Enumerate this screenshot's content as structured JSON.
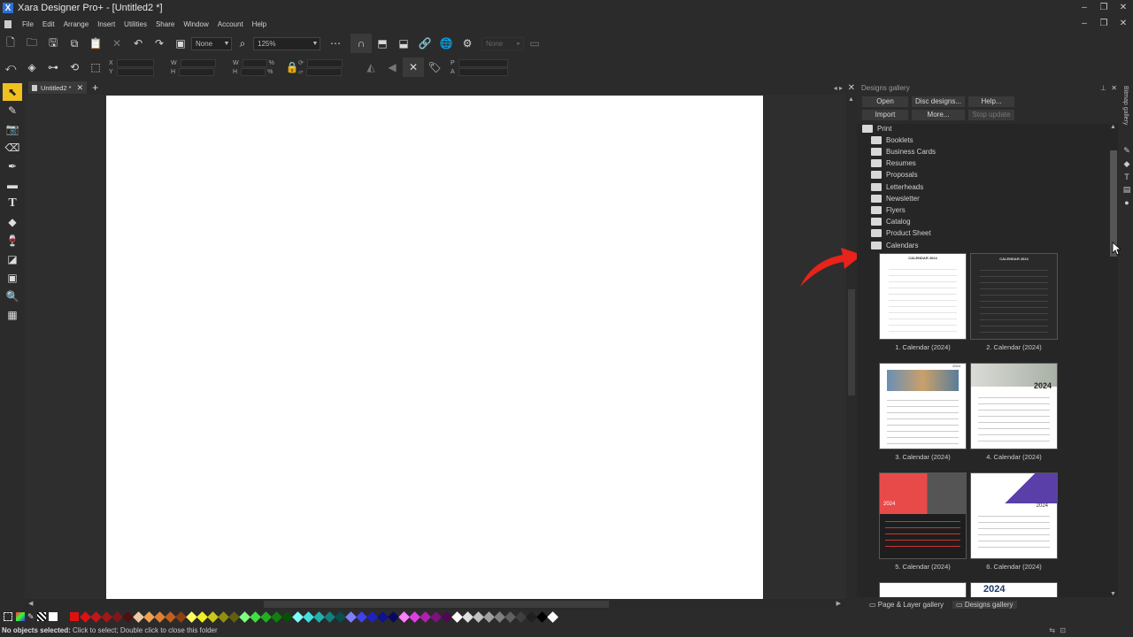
{
  "app": {
    "title": "Xara Designer Pro+ - [Untitled2 *]"
  },
  "menu": [
    "File",
    "Edit",
    "Arrange",
    "Insert",
    "Utilities",
    "Share",
    "Window",
    "Account",
    "Help"
  ],
  "toolbar": {
    "feather_value": "None",
    "zoom_value": "125%",
    "line_value": "None",
    "x_label": "X",
    "y_label": "Y",
    "w_label": "W",
    "h_label": "H",
    "w2_label": "W",
    "h2_label": "H",
    "p_label": "P",
    "a_label": "A",
    "pct1": "%",
    "pct2": "%"
  },
  "document": {
    "tab_label": "Untitled2 *"
  },
  "gallery": {
    "title": "Designs gallery",
    "buttons": {
      "open": "Open",
      "disc_designs": "Disc designs...",
      "help": "Help...",
      "import": "Import",
      "more": "More...",
      "stop_update": "Stop update"
    },
    "root": "Print",
    "folders": [
      "Booklets",
      "Business Cards",
      "Resumes",
      "Proposals",
      "Letterheads",
      "Newsletter",
      "Flyers",
      "Catalog",
      "Product Sheet",
      "Calendars"
    ],
    "items": [
      {
        "caption": "1. Calendar (2024)",
        "header": "CALENDAR 2024"
      },
      {
        "caption": "2. Calendar (2024)",
        "header": "CALENDAR 2024"
      },
      {
        "caption": "3. Calendar (2024)",
        "header": "2024"
      },
      {
        "caption": "4. Calendar (2024)",
        "header": "2024"
      },
      {
        "caption": "5. Calendar (2024)",
        "header": "2024"
      },
      {
        "caption": "6. Calendar (2024)",
        "header": "2024"
      },
      {
        "caption": "",
        "header": "2024"
      }
    ],
    "bottom_tabs": {
      "page_layer": "Page & Layer gallery",
      "designs": "Designs gallery"
    },
    "side_tab": "Bitmap gallery"
  },
  "status": {
    "bold": "No objects selected:",
    "text": "Click to select; Double click to close this folder"
  },
  "colors": {
    "accent": "#f0c020",
    "arrow": "#e8231b",
    "bg": "#2b2b2b"
  }
}
